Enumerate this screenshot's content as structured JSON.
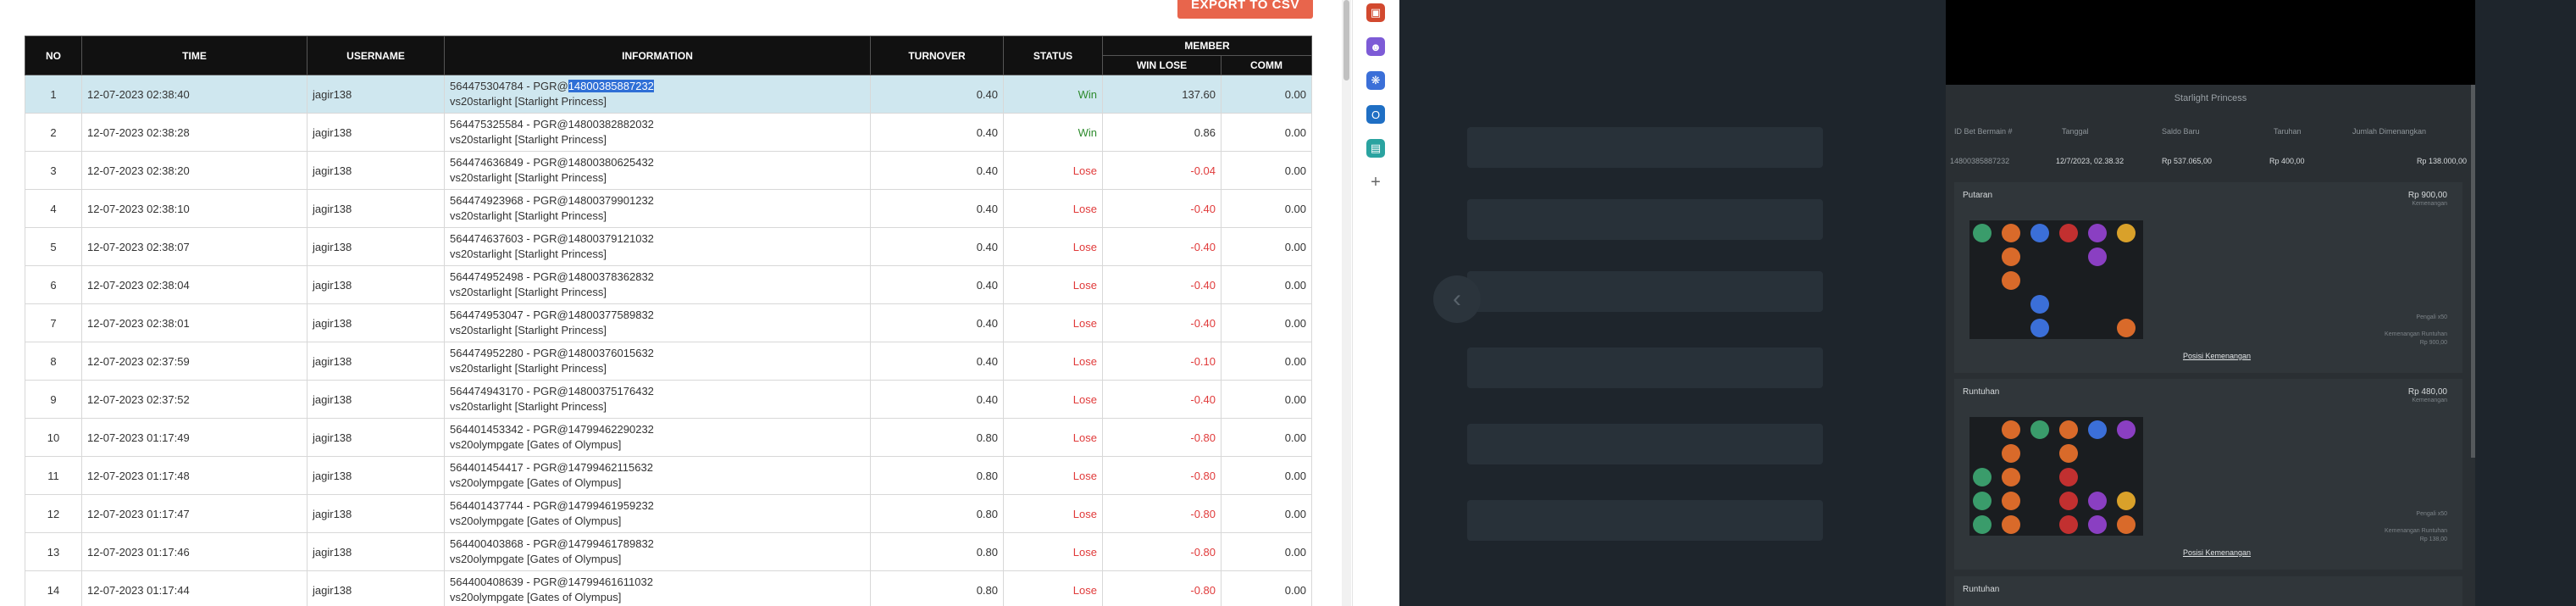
{
  "report": {
    "export_label": "EXPORT TO CSV",
    "headers": {
      "no": "NO",
      "time": "TIME",
      "username": "USERNAME",
      "information": "INFORMATION",
      "turnover": "TURNOVER",
      "status": "STATUS",
      "member": "MEMBER",
      "winlose": "WIN LOSE",
      "comm": "COMM"
    },
    "rows": [
      {
        "no": "1",
        "time": "12-07-2023 02:38:40",
        "user": "jagir138",
        "info_pre": "564475304784 - PGR@",
        "info_hl": "14800385887232",
        "info2": "vs20starlight [Starlight Princess]",
        "turnover": "0.40",
        "status": "Win",
        "winlose": "137.60",
        "comm": "0.00"
      },
      {
        "no": "2",
        "time": "12-07-2023 02:38:28",
        "user": "jagir138",
        "info_pre": "564475325584 - PGR@14800382882032",
        "info_hl": "",
        "info2": "vs20starlight [Starlight Princess]",
        "turnover": "0.40",
        "status": "Win",
        "winlose": "0.86",
        "comm": "0.00"
      },
      {
        "no": "3",
        "time": "12-07-2023 02:38:20",
        "user": "jagir138",
        "info_pre": "564474636849 - PGR@14800380625432",
        "info_hl": "",
        "info2": "vs20starlight [Starlight Princess]",
        "turnover": "0.40",
        "status": "Lose",
        "winlose": "-0.04",
        "comm": "0.00"
      },
      {
        "no": "4",
        "time": "12-07-2023 02:38:10",
        "user": "jagir138",
        "info_pre": "564474923968 - PGR@14800379901232",
        "info_hl": "",
        "info2": "vs20starlight [Starlight Princess]",
        "turnover": "0.40",
        "status": "Lose",
        "winlose": "-0.40",
        "comm": "0.00"
      },
      {
        "no": "5",
        "time": "12-07-2023 02:38:07",
        "user": "jagir138",
        "info_pre": "564474637603 - PGR@14800379121032",
        "info_hl": "",
        "info2": "vs20starlight [Starlight Princess]",
        "turnover": "0.40",
        "status": "Lose",
        "winlose": "-0.40",
        "comm": "0.00"
      },
      {
        "no": "6",
        "time": "12-07-2023 02:38:04",
        "user": "jagir138",
        "info_pre": "564474952498 - PGR@14800378362832",
        "info_hl": "",
        "info2": "vs20starlight [Starlight Princess]",
        "turnover": "0.40",
        "status": "Lose",
        "winlose": "-0.40",
        "comm": "0.00"
      },
      {
        "no": "7",
        "time": "12-07-2023 02:38:01",
        "user": "jagir138",
        "info_pre": "564474953047 - PGR@14800377589832",
        "info_hl": "",
        "info2": "vs20starlight [Starlight Princess]",
        "turnover": "0.40",
        "status": "Lose",
        "winlose": "-0.40",
        "comm": "0.00"
      },
      {
        "no": "8",
        "time": "12-07-2023 02:37:59",
        "user": "jagir138",
        "info_pre": "564474952280 - PGR@14800376015632",
        "info_hl": "",
        "info2": "vs20starlight [Starlight Princess]",
        "turnover": "0.40",
        "status": "Lose",
        "winlose": "-0.10",
        "comm": "0.00"
      },
      {
        "no": "9",
        "time": "12-07-2023 02:37:52",
        "user": "jagir138",
        "info_pre": "564474943170 - PGR@14800375176432",
        "info_hl": "",
        "info2": "vs20starlight [Starlight Princess]",
        "turnover": "0.40",
        "status": "Lose",
        "winlose": "-0.40",
        "comm": "0.00"
      },
      {
        "no": "10",
        "time": "12-07-2023 01:17:49",
        "user": "jagir138",
        "info_pre": "564401453342 - PGR@14799462290232",
        "info_hl": "",
        "info2": "vs20olympgate [Gates of Olympus]",
        "turnover": "0.80",
        "status": "Lose",
        "winlose": "-0.80",
        "comm": "0.00"
      },
      {
        "no": "11",
        "time": "12-07-2023 01:17:48",
        "user": "jagir138",
        "info_pre": "564401454417 - PGR@14799462115632",
        "info_hl": "",
        "info2": "vs20olympgate [Gates of Olympus]",
        "turnover": "0.80",
        "status": "Lose",
        "winlose": "-0.80",
        "comm": "0.00"
      },
      {
        "no": "12",
        "time": "12-07-2023 01:17:47",
        "user": "jagir138",
        "info_pre": "564401437744 - PGR@14799461959232",
        "info_hl": "",
        "info2": "vs20olympgate [Gates of Olympus]",
        "turnover": "0.80",
        "status": "Lose",
        "winlose": "-0.80",
        "comm": "0.00"
      },
      {
        "no": "13",
        "time": "12-07-2023 01:17:46",
        "user": "jagir138",
        "info_pre": "564400403868 - PGR@14799461789832",
        "info_hl": "",
        "info2": "vs20olympgate [Gates of Olympus]",
        "turnover": "0.80",
        "status": "Lose",
        "winlose": "-0.80",
        "comm": "0.00"
      },
      {
        "no": "14",
        "time": "12-07-2023 01:17:44",
        "user": "jagir138",
        "info_pre": "564400408639 - PGR@14799461611032",
        "info_hl": "",
        "info2": "vs20olympgate [Gates of Olympus]",
        "turnover": "0.80",
        "status": "Lose",
        "winlose": "-0.80",
        "comm": "0.00"
      }
    ]
  },
  "sidebar_icons": [
    {
      "name": "toolbox-icon",
      "color": "#d2492f"
    },
    {
      "name": "people-icon",
      "color": "#7d5bd6"
    },
    {
      "name": "extension-icon",
      "color": "#3b6fd8"
    },
    {
      "name": "outlook-icon",
      "color": "#1f6fc4"
    },
    {
      "name": "shopping-icon",
      "color": "#2aa3a0"
    },
    {
      "name": "add-icon",
      "color": "#ffffff"
    }
  ],
  "modal": {
    "title": "Starlight Princess",
    "headers": [
      "ID Bet Bermain #",
      "Tanggal",
      "Saldo Baru",
      "Taruhan",
      "Jumlah Dimenangkan"
    ],
    "values": [
      "14800385887232",
      "12/7/2023, 02.38.32",
      "Rp 537.065,00",
      "Rp 400,00",
      "Rp 138.000,00"
    ],
    "sections": [
      {
        "title": "Putaran",
        "amount": "Rp 900,00",
        "sub": "Kemenangan",
        "small1": "Pengali x50",
        "small2": "Kemenangan Runtuhan",
        "small3": "Rp 900,00",
        "link": "Posisi Kemenangan"
      },
      {
        "title": "Runtuhan",
        "amount": "Rp 480,00",
        "sub": "Kemenangan",
        "small1": "Pengali x50",
        "small2": "Kemenangan Runtuhan",
        "small3": "Rp 138,00",
        "link": "Posisi Kemenangan"
      },
      {
        "title": "Runtuhan",
        "amount": "",
        "sub": "",
        "small1": "",
        "small2": "",
        "small3": "",
        "link": ""
      }
    ]
  },
  "colors": {
    "win": "#2e8b2e",
    "lose": "#e03a3a",
    "accent": "#e8654c",
    "header": "#111111",
    "selected": "#cfe7ef",
    "highlight": "#2f6fd6"
  }
}
